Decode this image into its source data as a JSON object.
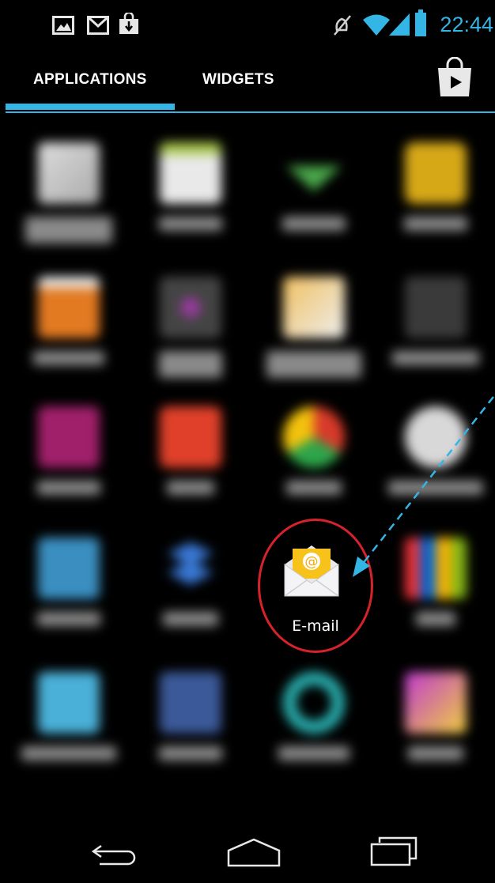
{
  "status_bar": {
    "time": "22:44",
    "notification_icons": [
      "image-icon",
      "gmail-icon",
      "store-download-icon"
    ],
    "system_icons": [
      "mute-icon",
      "wifi-icon",
      "signal-icon",
      "battery-icon"
    ],
    "accent_color": "#33b5e5"
  },
  "tabs": {
    "applications": "APPLICATIONS",
    "widgets": "WIDGETS",
    "selected": "APPLICATIONS",
    "store_icon": "play-store-icon"
  },
  "highlight": {
    "app_label": "E-mail",
    "icon": "email-envelope-icon",
    "ring_color": "#d6222a",
    "arrow_color": "#33b5e5"
  },
  "navigation": {
    "back_icon": "back-icon",
    "home_icon": "home-icon",
    "recents_icon": "recent-apps-icon"
  }
}
